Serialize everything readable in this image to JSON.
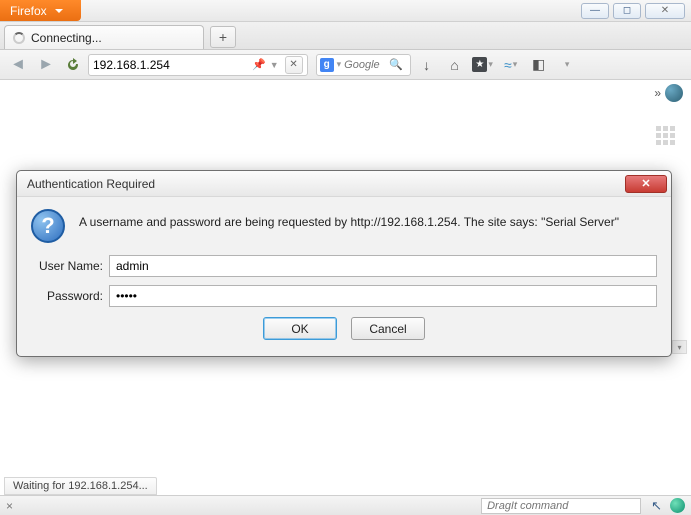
{
  "app": {
    "name": "Firefox"
  },
  "window_controls": {
    "min": "—",
    "max": "◻",
    "close": "✕"
  },
  "tab": {
    "title": "Connecting..."
  },
  "newtab": {
    "glyph": "+"
  },
  "nav": {
    "back": "◄",
    "forward": "►",
    "reload": "↻"
  },
  "urlbar": {
    "value": "192.168.1.254",
    "pin": "📌",
    "dropdown": "▼",
    "stop": "✕"
  },
  "search": {
    "engine_badge": "g",
    "placeholder": "Google",
    "dropdown": "▾",
    "go": "🔍"
  },
  "toolbar": {
    "download": "↓",
    "home": "⌂",
    "bookmark_star": "★",
    "sync": "≈",
    "sidebar": "◧",
    "dd": "▾"
  },
  "content": {
    "chevrons": "»",
    "scroll_down": "▾"
  },
  "dialog": {
    "title": "Authentication Required",
    "close": "✕",
    "question": "?",
    "message": "A username and password are being requested by http://192.168.1.254. The site says: \"Serial Server\"",
    "username_label": "User Name:",
    "username_value": "admin",
    "password_label": "Password:",
    "password_value": "•••••",
    "ok": "OK",
    "cancel": "Cancel"
  },
  "status": {
    "text": "Waiting for 192.168.1.254..."
  },
  "bottom": {
    "close": "×",
    "dragit_placeholder": "DragIt command",
    "cursor": "↖"
  }
}
